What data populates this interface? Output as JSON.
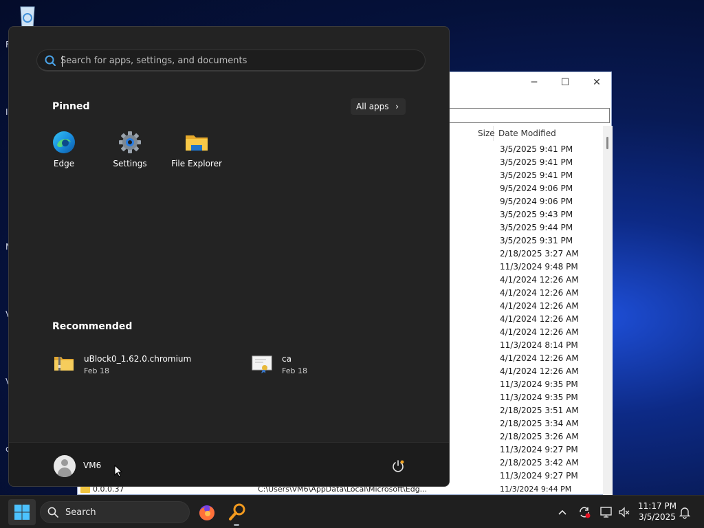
{
  "start_menu": {
    "search_placeholder": "Search for apps, settings, and documents",
    "pinned_title": "Pinned",
    "all_apps_label": "All apps",
    "pinned": [
      {
        "label": "Edge",
        "icon": "edge-icon"
      },
      {
        "label": "Settings",
        "icon": "settings-gear-icon"
      },
      {
        "label": "File Explorer",
        "icon": "folder-icon"
      }
    ],
    "recommended_title": "Recommended",
    "recommended": [
      {
        "name": "uBlock0_1.62.0.chromium",
        "date": "Feb 18",
        "icon": "zip-folder-icon"
      },
      {
        "name": "ca",
        "date": "Feb 18",
        "icon": "certificate-icon"
      }
    ],
    "user_name": "VM6"
  },
  "explorer": {
    "columns": {
      "size": "Size",
      "date_modified": "Date Modified"
    },
    "dates": [
      "3/5/2025 9:41 PM",
      "3/5/2025 9:41 PM",
      "3/5/2025 9:41 PM",
      "9/5/2024 9:06 PM",
      "9/5/2024 9:06 PM",
      "3/5/2025 9:43 PM",
      "3/5/2025 9:44 PM",
      "3/5/2025 9:31 PM",
      "2/18/2025 3:27 AM",
      "11/3/2024 9:48 PM",
      "4/1/2024 12:26 AM",
      "4/1/2024 12:26 AM",
      "4/1/2024 12:26 AM",
      "4/1/2024 12:26 AM",
      "4/1/2024 12:26 AM",
      "11/3/2024 8:14 PM",
      "4/1/2024 12:26 AM",
      "4/1/2024 12:26 AM",
      "11/3/2024 9:35 PM",
      "11/3/2024 9:35 PM",
      "2/18/2025 3:51 AM",
      "2/18/2025 3:34 AM",
      "2/18/2025 3:26 AM",
      "11/3/2024 9:27 PM",
      "2/18/2025 3:42 AM",
      "11/3/2024 9:27 PM",
      "11/3/2024 9:44 PM"
    ],
    "bottom_row": {
      "name": "0.0.0.37",
      "path": "C:\\Users\\VM6\\AppData\\Local\\Microsoft\\Edg..."
    }
  },
  "taskbar": {
    "search_label": "Search",
    "clock_time": "11:17 PM",
    "clock_date": "3/5/2025"
  },
  "colors": {
    "accent": "#0078d4",
    "start_bg": "#232323",
    "taskbar_bg": "#1f1f1f"
  }
}
